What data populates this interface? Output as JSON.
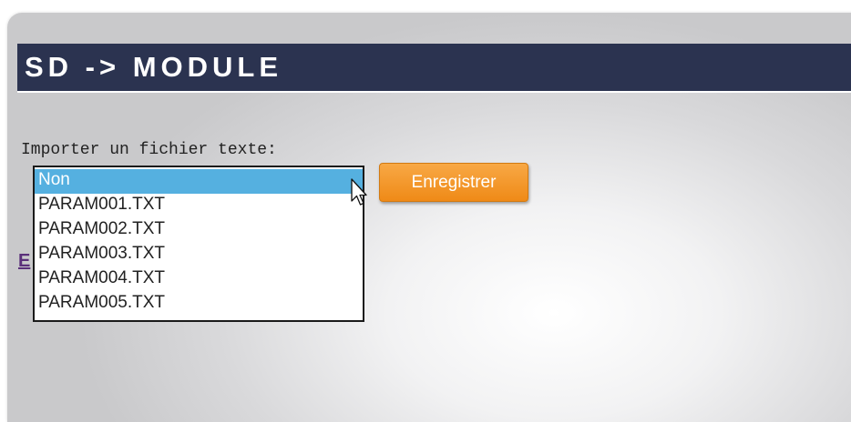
{
  "header": {
    "title": "SD -> MODULE"
  },
  "import": {
    "label": "Importer un fichier texte:",
    "hidden_link_fragment": "E",
    "dropdown_options": [
      {
        "label": "Non",
        "selected": true
      },
      {
        "label": "PARAM001.TXT",
        "selected": false
      },
      {
        "label": "PARAM002.TXT",
        "selected": false
      },
      {
        "label": "PARAM003.TXT",
        "selected": false
      },
      {
        "label": "PARAM004.TXT",
        "selected": false
      },
      {
        "label": "PARAM005.TXT",
        "selected": false
      }
    ],
    "save_label": "Enregistrer"
  },
  "colors": {
    "title_bar": "#2b3350",
    "selected_option": "#55b0e0",
    "save_button": "#f39a2a",
    "link": "#5a2f7a"
  },
  "icons": {
    "cursor": "mouse-pointer-icon"
  }
}
